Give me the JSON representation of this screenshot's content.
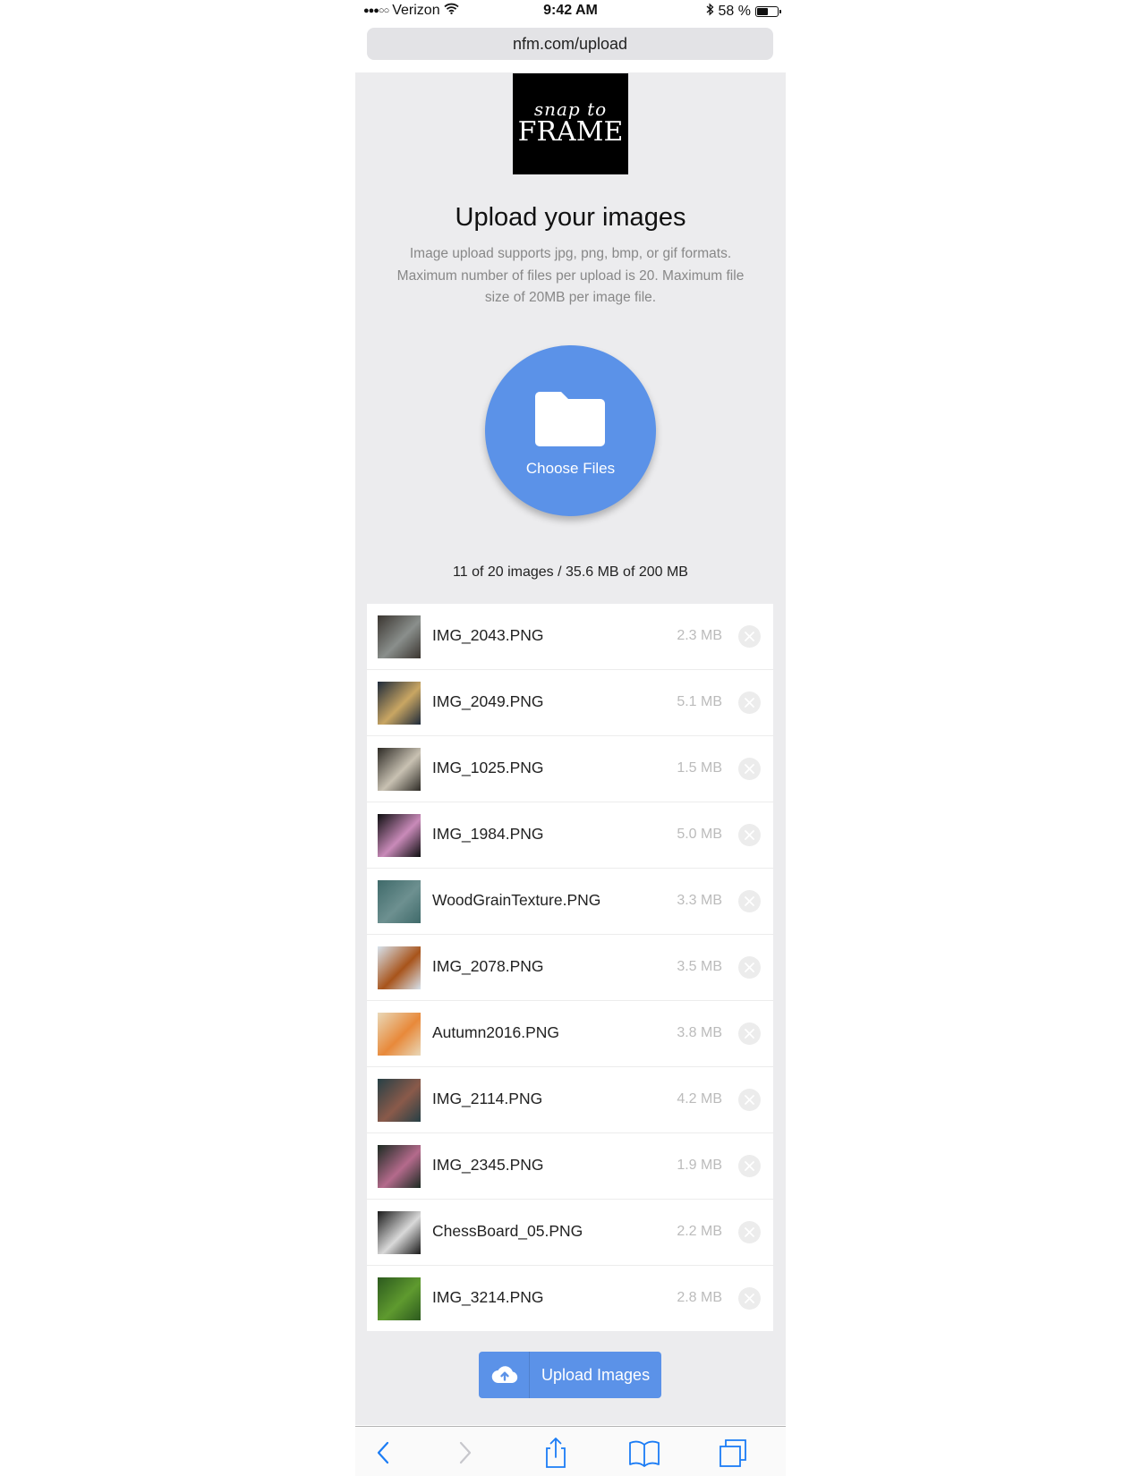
{
  "status_bar": {
    "signal": "●●●○○",
    "carrier": "Verizon",
    "time": "9:42 AM",
    "battery": "58 %",
    "battery_level": 0.58
  },
  "browser": {
    "url": "nfm.com/upload"
  },
  "logo": {
    "line1": "snap to",
    "line2": "FRAME"
  },
  "page": {
    "title": "Upload your images",
    "description": "Image upload supports jpg, png, bmp, or gif formats. Maximum number of files per upload is 20. Maximum file size of 20MB per image file.",
    "choose_files_label": "Choose Files",
    "summary": "11 of 20 images / 35.6 MB of 200 MB",
    "upload_label": "Upload Images"
  },
  "files": [
    {
      "name": "IMG_2043.PNG",
      "size": "2.3 MB",
      "thumb_colors": [
        "#3a3530",
        "#8a8f8c"
      ]
    },
    {
      "name": "IMG_2049.PNG",
      "size": "5.1 MB",
      "thumb_colors": [
        "#1e2a3a",
        "#c9a663"
      ]
    },
    {
      "name": "IMG_1025.PNG",
      "size": "1.5 MB",
      "thumb_colors": [
        "#2d2a25",
        "#c8c1b2"
      ]
    },
    {
      "name": "IMG_1984.PNG",
      "size": "5.0 MB",
      "thumb_colors": [
        "#0e0e10",
        "#c98ab9"
      ]
    },
    {
      "name": "WoodGrainTexture.PNG",
      "size": "3.3 MB",
      "thumb_colors": [
        "#3f6a6a",
        "#6d9090"
      ]
    },
    {
      "name": "IMG_2078.PNG",
      "size": "3.5 MB",
      "thumb_colors": [
        "#d7e2ec",
        "#a8541b"
      ]
    },
    {
      "name": "Autumn2016.PNG",
      "size": "3.8 MB",
      "thumb_colors": [
        "#e9d8b8",
        "#e8893a"
      ]
    },
    {
      "name": "IMG_2114.PNG",
      "size": "4.2 MB",
      "thumb_colors": [
        "#274046",
        "#8a5a4a"
      ]
    },
    {
      "name": "IMG_2345.PNG",
      "size": "1.9 MB",
      "thumb_colors": [
        "#1c2b22",
        "#b46a8c"
      ]
    },
    {
      "name": "ChessBoard_05.PNG",
      "size": "2.2 MB",
      "thumb_colors": [
        "#1a1a1a",
        "#d9d9d9"
      ]
    },
    {
      "name": "IMG_3214.PNG",
      "size": "2.8 MB",
      "thumb_colors": [
        "#2c5a1e",
        "#5f9a2f"
      ]
    }
  ],
  "colors": {
    "accent": "#5b92e8",
    "page_background": "#ececee",
    "toolbar_icon": "#1b7cf5",
    "toolbar_icon_disabled": "#c7c7cc"
  },
  "icons": {
    "wifi": "wifi-icon",
    "bluetooth": "bluetooth-icon",
    "battery": "battery-icon",
    "choose_files": "folder-icon",
    "remove": "close-circle-icon",
    "upload": "cloud-upload-icon",
    "toolbar": [
      "back-arrow-icon",
      "forward-arrow-icon",
      "share-icon",
      "bookmarks-icon",
      "tabs-icon"
    ]
  }
}
